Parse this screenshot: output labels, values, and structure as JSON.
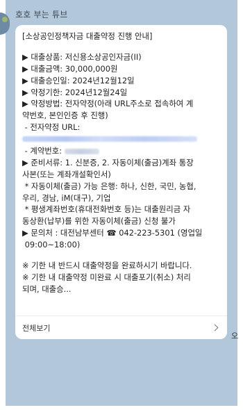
{
  "chat": {
    "sender_name": "호호 부는 튜브",
    "edge_text": "오"
  },
  "message": {
    "lines": [
      "[소상공인정책자금 대출약정 진행 안내]",
      "",
      "▶ 대출상품: 저신용소상공인자금(II)",
      "▶ 대출금액: 30,000,000원",
      "▶ 대출승인일: 2024년12월12일",
      "▶ 약정기한: 2024년12월24일",
      "▶ 약정방법: 전자약정(아래 URL주소로 접속하여 계",
      "약번호, 본인인증 후 진행)",
      " - 전자약정 URL:",
      "",
      " - 계약번호:",
      "▶ 준비서류: 1. 신분증, 2. 자동이체(출금)계좌 통장",
      "사본(또는 계좌개설확인서)",
      " * 자동이체(출금) 가능 은행: 하나, 신한, 국민, 농협,",
      "우리, 경남, iM(대구), 기업",
      " * 평생계좌번호(휴대전화번호 등)는 대출원리금 자",
      "동상환(납부)를 위한 자동이체(출금) 신청 불가",
      "▶ 문의처 : 대전남부센터 ☎ 042-223-5301 (영업일",
      " 09:00~18:00)",
      "",
      "※ 기한 내 반드시 대출약정을 완료하시기 바랍니다.",
      "※ 기한 내 대출약정 미완료 시 대출포기(취소) 처리",
      "되며, 대출승..."
    ],
    "see_all_label": "전체보기"
  },
  "colors": {
    "chat_background": "#b2c7da",
    "bubble": "#ffffff"
  },
  "icons": {
    "see_all": "chevron-right-icon",
    "avatar": "profile-avatar"
  }
}
